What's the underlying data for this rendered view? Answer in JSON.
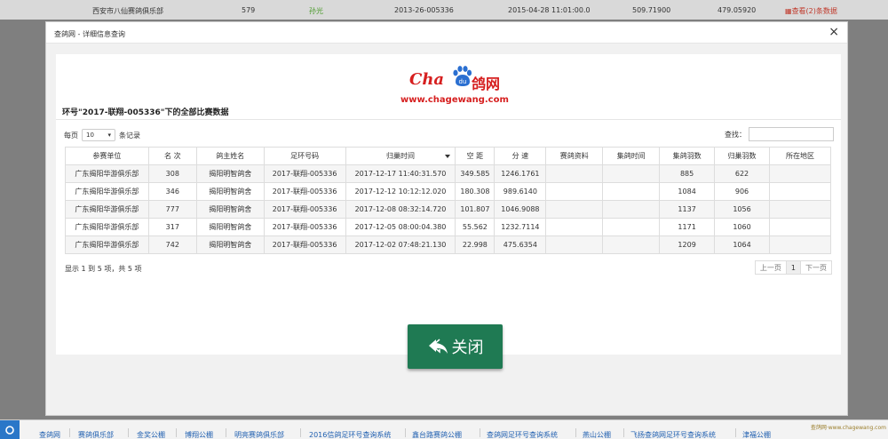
{
  "background_row": {
    "club": "西安市八仙赛鸽俱乐部",
    "rank": "579",
    "owner": "孙光",
    "ring": "2013-26-005336",
    "time": "2015-04-28 11:01:00.0",
    "distance": "509.71900",
    "speed": "479.05920",
    "link": "查看(2)条数据"
  },
  "modal": {
    "title": "查鸽网 - 详细信息查询",
    "close": "×",
    "logo_cha": "Cha",
    "logo_paw_text": "du",
    "logo_cn": "鸽网",
    "logo_url": "www.chagewang.com",
    "heading": "环号\"2017-联翔-005336\"下的全部比赛数据",
    "page_size_prefix": "每页",
    "page_size_value": "10",
    "page_size_suffix": "条记录",
    "search_label": "查找：",
    "search_value": "",
    "columns": [
      "参赛单位",
      "名 次",
      "鸽主姓名",
      "足环号码",
      "归巢时间",
      "空 距",
      "分 速",
      "赛鸽资料",
      "集鸽时间",
      "集鸽羽数",
      "归巢羽数",
      "所在地区"
    ],
    "rows": [
      [
        "广东揭阳华游俱乐部",
        "308",
        "揭阳明智鸽舍",
        "2017-联翔-005336",
        "2017-12-17 11:40:31.570",
        "349.585",
        "1246.1761",
        "",
        "",
        "885",
        "622",
        ""
      ],
      [
        "广东揭阳华游俱乐部",
        "346",
        "揭阳明智鸽舍",
        "2017-联翔-005336",
        "2017-12-12 10:12:12.020",
        "180.308",
        "989.6140",
        "",
        "",
        "1084",
        "906",
        ""
      ],
      [
        "广东揭阳华游俱乐部",
        "777",
        "揭阳明智鸽舍",
        "2017-联翔-005336",
        "2017-12-08 08:32:14.720",
        "101.807",
        "1046.9088",
        "",
        "",
        "1137",
        "1056",
        ""
      ],
      [
        "广东揭阳华游俱乐部",
        "317",
        "揭阳明智鸽舍",
        "2017-联翔-005336",
        "2017-12-05 08:00:04.380",
        "55.562",
        "1232.7114",
        "",
        "",
        "1171",
        "1060",
        ""
      ],
      [
        "广东揭阳华游俱乐部",
        "742",
        "揭阳明智鸽舍",
        "2017-联翔-005336",
        "2017-12-02 07:48:21.130",
        "22.998",
        "475.6354",
        "",
        "",
        "1209",
        "1064",
        ""
      ]
    ],
    "info": "显示 1 到 5 项，共 5 项",
    "pager": {
      "prev": "上一页",
      "current": "1",
      "next": "下一页"
    },
    "close_button": "关闭"
  },
  "bottom_bar": {
    "items": [
      "查鸽网",
      "赛鸽俱乐部",
      "金奖公棚",
      "博翔公棚",
      "明亮赛鸽俱乐部",
      "2016信鸽足环号查询系统",
      "鑫台路赛鸽公棚",
      "查鸽网足环号查询系统",
      "燕山公棚",
      "飞扬查鸽网足环号查询系统",
      "津福公棚"
    ],
    "watermark": "查鸽网·www.chagewang.com"
  },
  "colors": {
    "brand_red": "#d61f1f",
    "close_green": "#1f7a53",
    "link_blue": "#1f5fb0"
  }
}
